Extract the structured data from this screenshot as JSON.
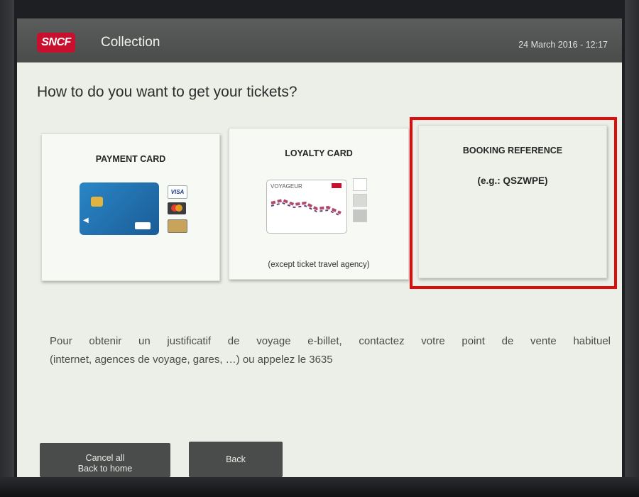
{
  "header": {
    "brand": "SNCF",
    "title": "Collection",
    "datetime": "24 March 2016 - 12:17"
  },
  "main": {
    "question": "How to do you want to get your tickets?",
    "options": [
      {
        "label": "PAYMENT CARD",
        "icon": "payment-card-icon"
      },
      {
        "label": "LOYALTY CARD",
        "note": "(except ticket travel agency)",
        "icon": "loyalty-card-icon",
        "card_text": "VOYAGEUR"
      },
      {
        "label": "BOOKING REFERENCE",
        "example": "(e.g.: QSZWPE)",
        "highlighted": true
      }
    ],
    "info_line1": "Pour obtenir un justificatif de voyage e-billet, contactez votre point de vente habituel",
    "info_line2": "(internet, agences de voyage, gares, …) ou appelez le 3635"
  },
  "footer": {
    "cancel_line1": "Cancel all",
    "cancel_line2": "Back to home",
    "back_label": "Back"
  },
  "colors": {
    "brand_red": "#c8102e",
    "header_bg": "#4a4c4b",
    "screen_bg": "#ecefe7",
    "highlight": "#e00b0b"
  }
}
